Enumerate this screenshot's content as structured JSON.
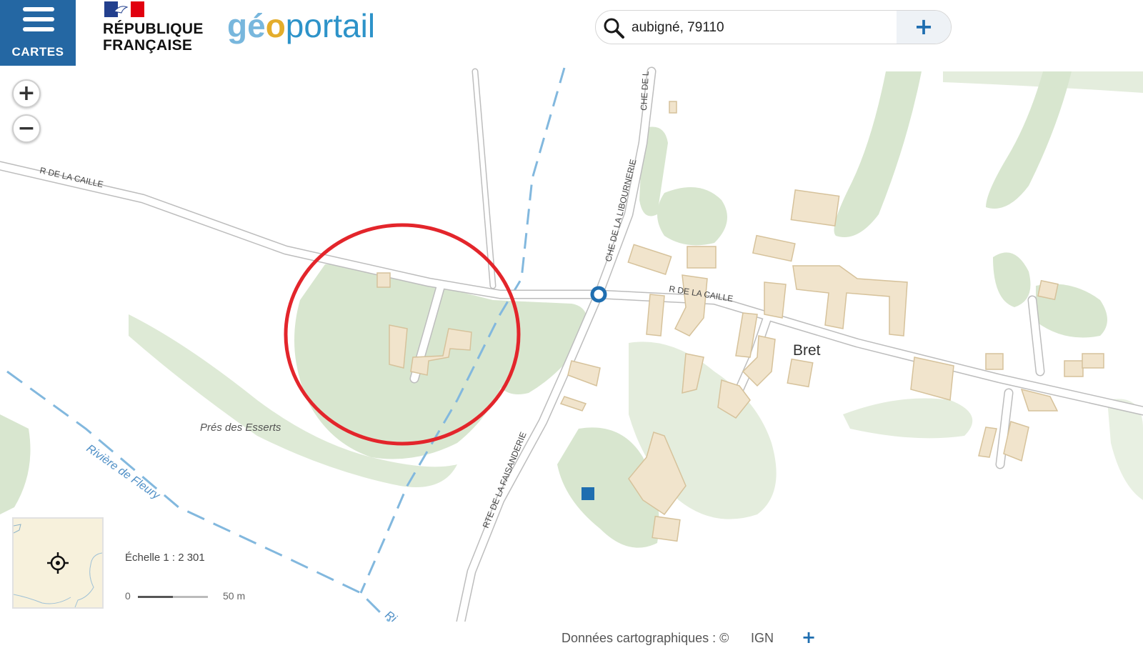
{
  "header": {
    "menu_label": "CARTES",
    "rf_line1": "RÉPUBLIQUE",
    "rf_line2": "FRANÇAISE",
    "logo_part1": "gé",
    "logo_part2": "o",
    "logo_part3": "portail"
  },
  "search": {
    "value": "aubigné, 79110",
    "button_label": "+"
  },
  "map": {
    "zoom_in": "+",
    "zoom_out": "−",
    "labels": {
      "road_caille_west": "R DE LA CAILLE",
      "road_caille_east": "R DE LA CAILLE",
      "road_libournerie": "CHE DE LA LIBOURNERIE",
      "road_che_north": "CHE DE L",
      "road_faisanderie": "RTE DE LA FAISANDERIE",
      "place_bret": "Bret",
      "place_pres": "Prés des Esserts",
      "river": "Rivière de Fleury",
      "river_short": "Ri"
    },
    "colors": {
      "vegetation": "#d8e6cf",
      "building_fill": "#f1e4cc",
      "building_stroke": "#d6c29b",
      "road": "#ffffff",
      "road_casing": "#bdbdbd",
      "river": "#82b8de",
      "highlight_circle": "#e3252b",
      "marker": "#1f6eb0"
    },
    "highlight": "red circle annotation"
  },
  "scale": {
    "text": "Échelle 1 : 2 301",
    "zero": "0",
    "distance": "50 m",
    "bar_filled_fraction": 0.5
  },
  "attribution": {
    "text": "Données cartographiques : ©",
    "source": "IGN",
    "more": "+"
  }
}
